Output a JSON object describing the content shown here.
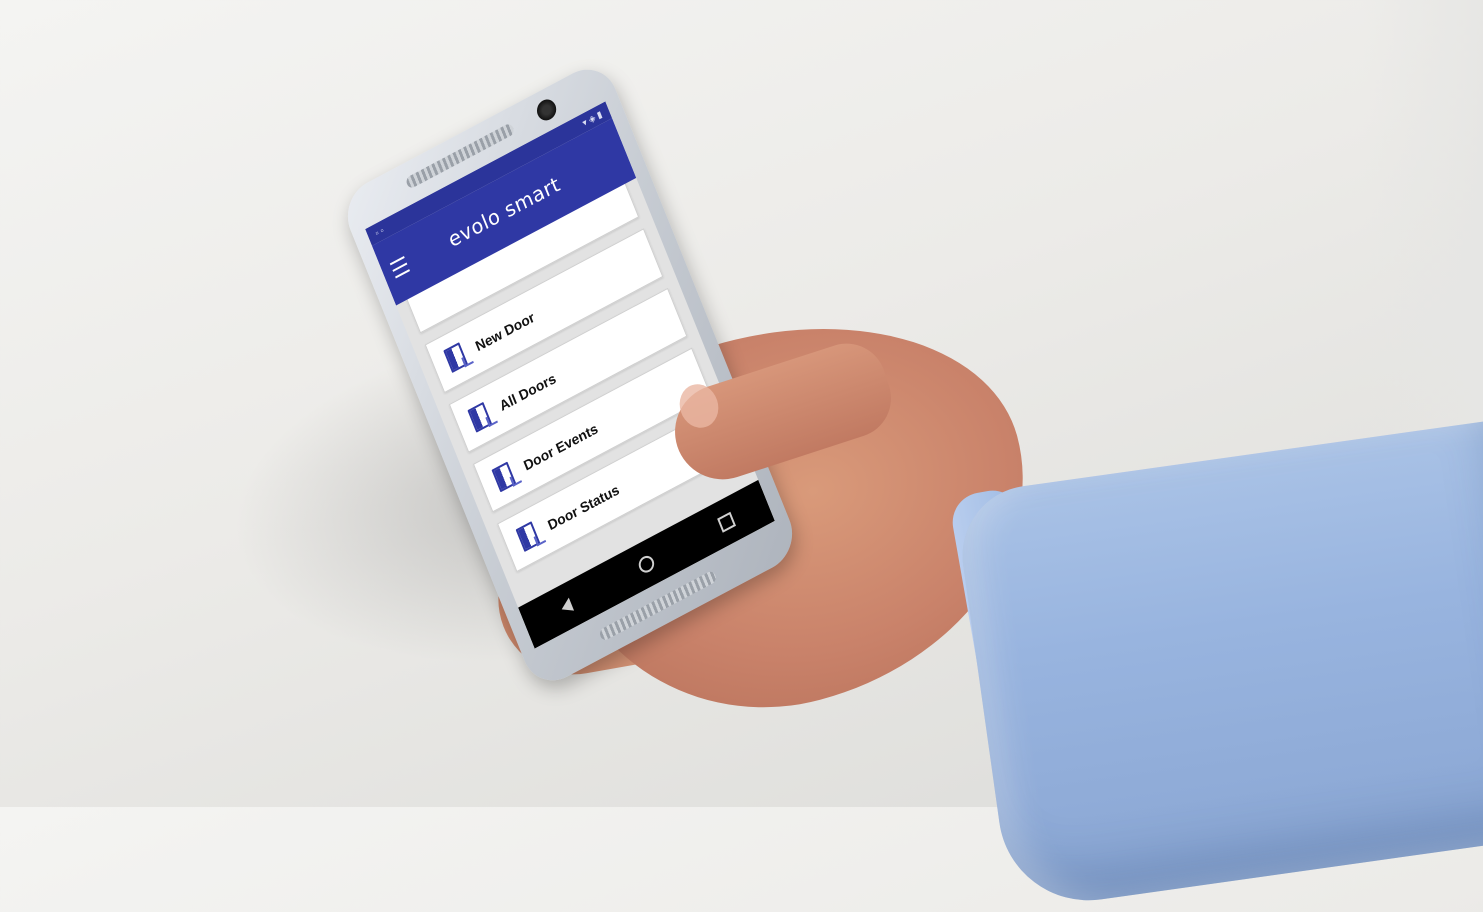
{
  "app": {
    "title": "evolo smart"
  },
  "menu": {
    "items": [
      {
        "label": "New Door",
        "icon": "new-door-icon"
      },
      {
        "label": "All Doors",
        "icon": "all-doors-icon"
      },
      {
        "label": "Door Events",
        "icon": "door-events-icon"
      },
      {
        "label": "Door Status",
        "icon": "door-status-icon"
      }
    ]
  },
  "colors": {
    "app_bar": "#2f38a4",
    "status_bar": "#2b349a",
    "nav_bar": "#000000",
    "sleeve": "#98b4df"
  }
}
